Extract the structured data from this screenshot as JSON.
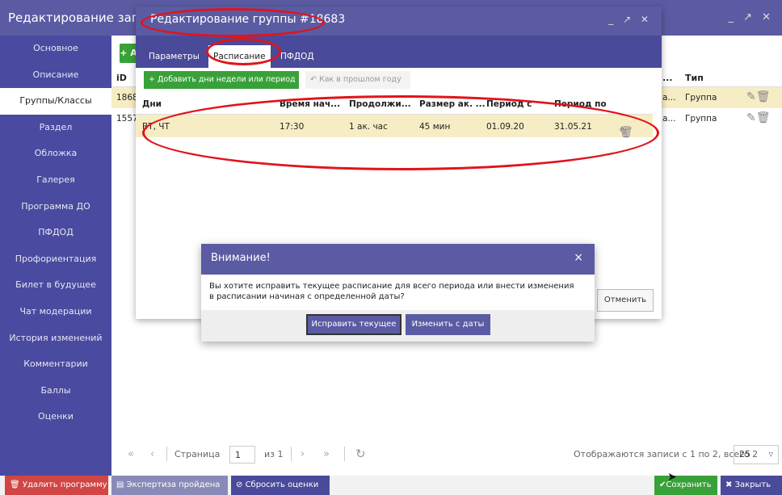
{
  "outer": {
    "title": "Редактирование записи",
    "window_controls": "_ ↗ ✕",
    "add_label": "+ А",
    "sidebar": [
      {
        "label": "Основное"
      },
      {
        "label": "Описание"
      },
      {
        "label": "Группы/Классы"
      },
      {
        "label": "Раздел"
      },
      {
        "label": "Обложка"
      },
      {
        "label": "Галерея"
      },
      {
        "label": "Программа ДО"
      },
      {
        "label": "ПФДОД"
      },
      {
        "label": "Профориентация"
      },
      {
        "label": "Билет в будущее"
      },
      {
        "label": "Чат модерации"
      },
      {
        "label": "История изменений"
      },
      {
        "label": "Комментарии"
      },
      {
        "label": "Баллы"
      },
      {
        "label": "Оценки"
      }
    ],
    "active_sidebar_index": 2,
    "table": {
      "headers": {
        "id": "iD",
        "dots": "...",
        "type": "Тип"
      },
      "rows": [
        {
          "id": "1868",
          "dots": "а...",
          "type": "Группа"
        },
        {
          "id": "1557",
          "dots": "а...",
          "type": "Группа"
        }
      ]
    },
    "pager": {
      "page_label": "Страница",
      "page_value": "1",
      "of_label": "из 1",
      "info": "Отображаются записи с 1 по 2, всего 2",
      "page_size": "25"
    },
    "bottom": {
      "delete": "Удалить программу",
      "expert": "Экспертиза пройдена",
      "reset": "Сбросить оценки",
      "save": "Сохранить",
      "close": "Закрыть"
    }
  },
  "inner": {
    "title": "Редактирование группы #18683",
    "window_controls": "_ ↗ ✕",
    "tabs": [
      {
        "label": "Параметры"
      },
      {
        "label": "Расписание"
      },
      {
        "label": "ПФДОД"
      }
    ],
    "active_tab_index": 1,
    "toolbar": {
      "add_days": "+ Добавить дни недели или период",
      "last_year": "Как в прошлом году"
    },
    "schedule": {
      "headers": [
        "Дни",
        "Время нач...",
        "Продолжи...",
        "Размер ак. ...",
        "Период с",
        "Период по"
      ],
      "rows": [
        [
          "ВТ, ЧТ",
          "17:30",
          "1 ак. час",
          "45 мин",
          "01.09.20",
          "31.05.21"
        ]
      ]
    },
    "cancel": "Отменить"
  },
  "dialog": {
    "title": "Внимание!",
    "close": "×",
    "message": "Вы хотите исправить текущее расписание для всего периода или внести изменения в расписании начиная с определенной даты?",
    "fix_current": "Исправить текущее",
    "change_from_date": "Изменить с даты"
  },
  "colors": {
    "header": "#5b5ba3",
    "sidebar": "#4a4aa0",
    "add_green": "#39a139",
    "highlight_row": "#f7edc4",
    "delete_red": "#d24545",
    "annotation_red": "#e0141a"
  },
  "icons": {
    "edit": "pencil-icon",
    "delete": "trash-icon",
    "refresh": "refresh-icon",
    "undo": "undo-icon",
    "reset": "ban-icon",
    "save": "check-icon",
    "close": "close-icon"
  }
}
